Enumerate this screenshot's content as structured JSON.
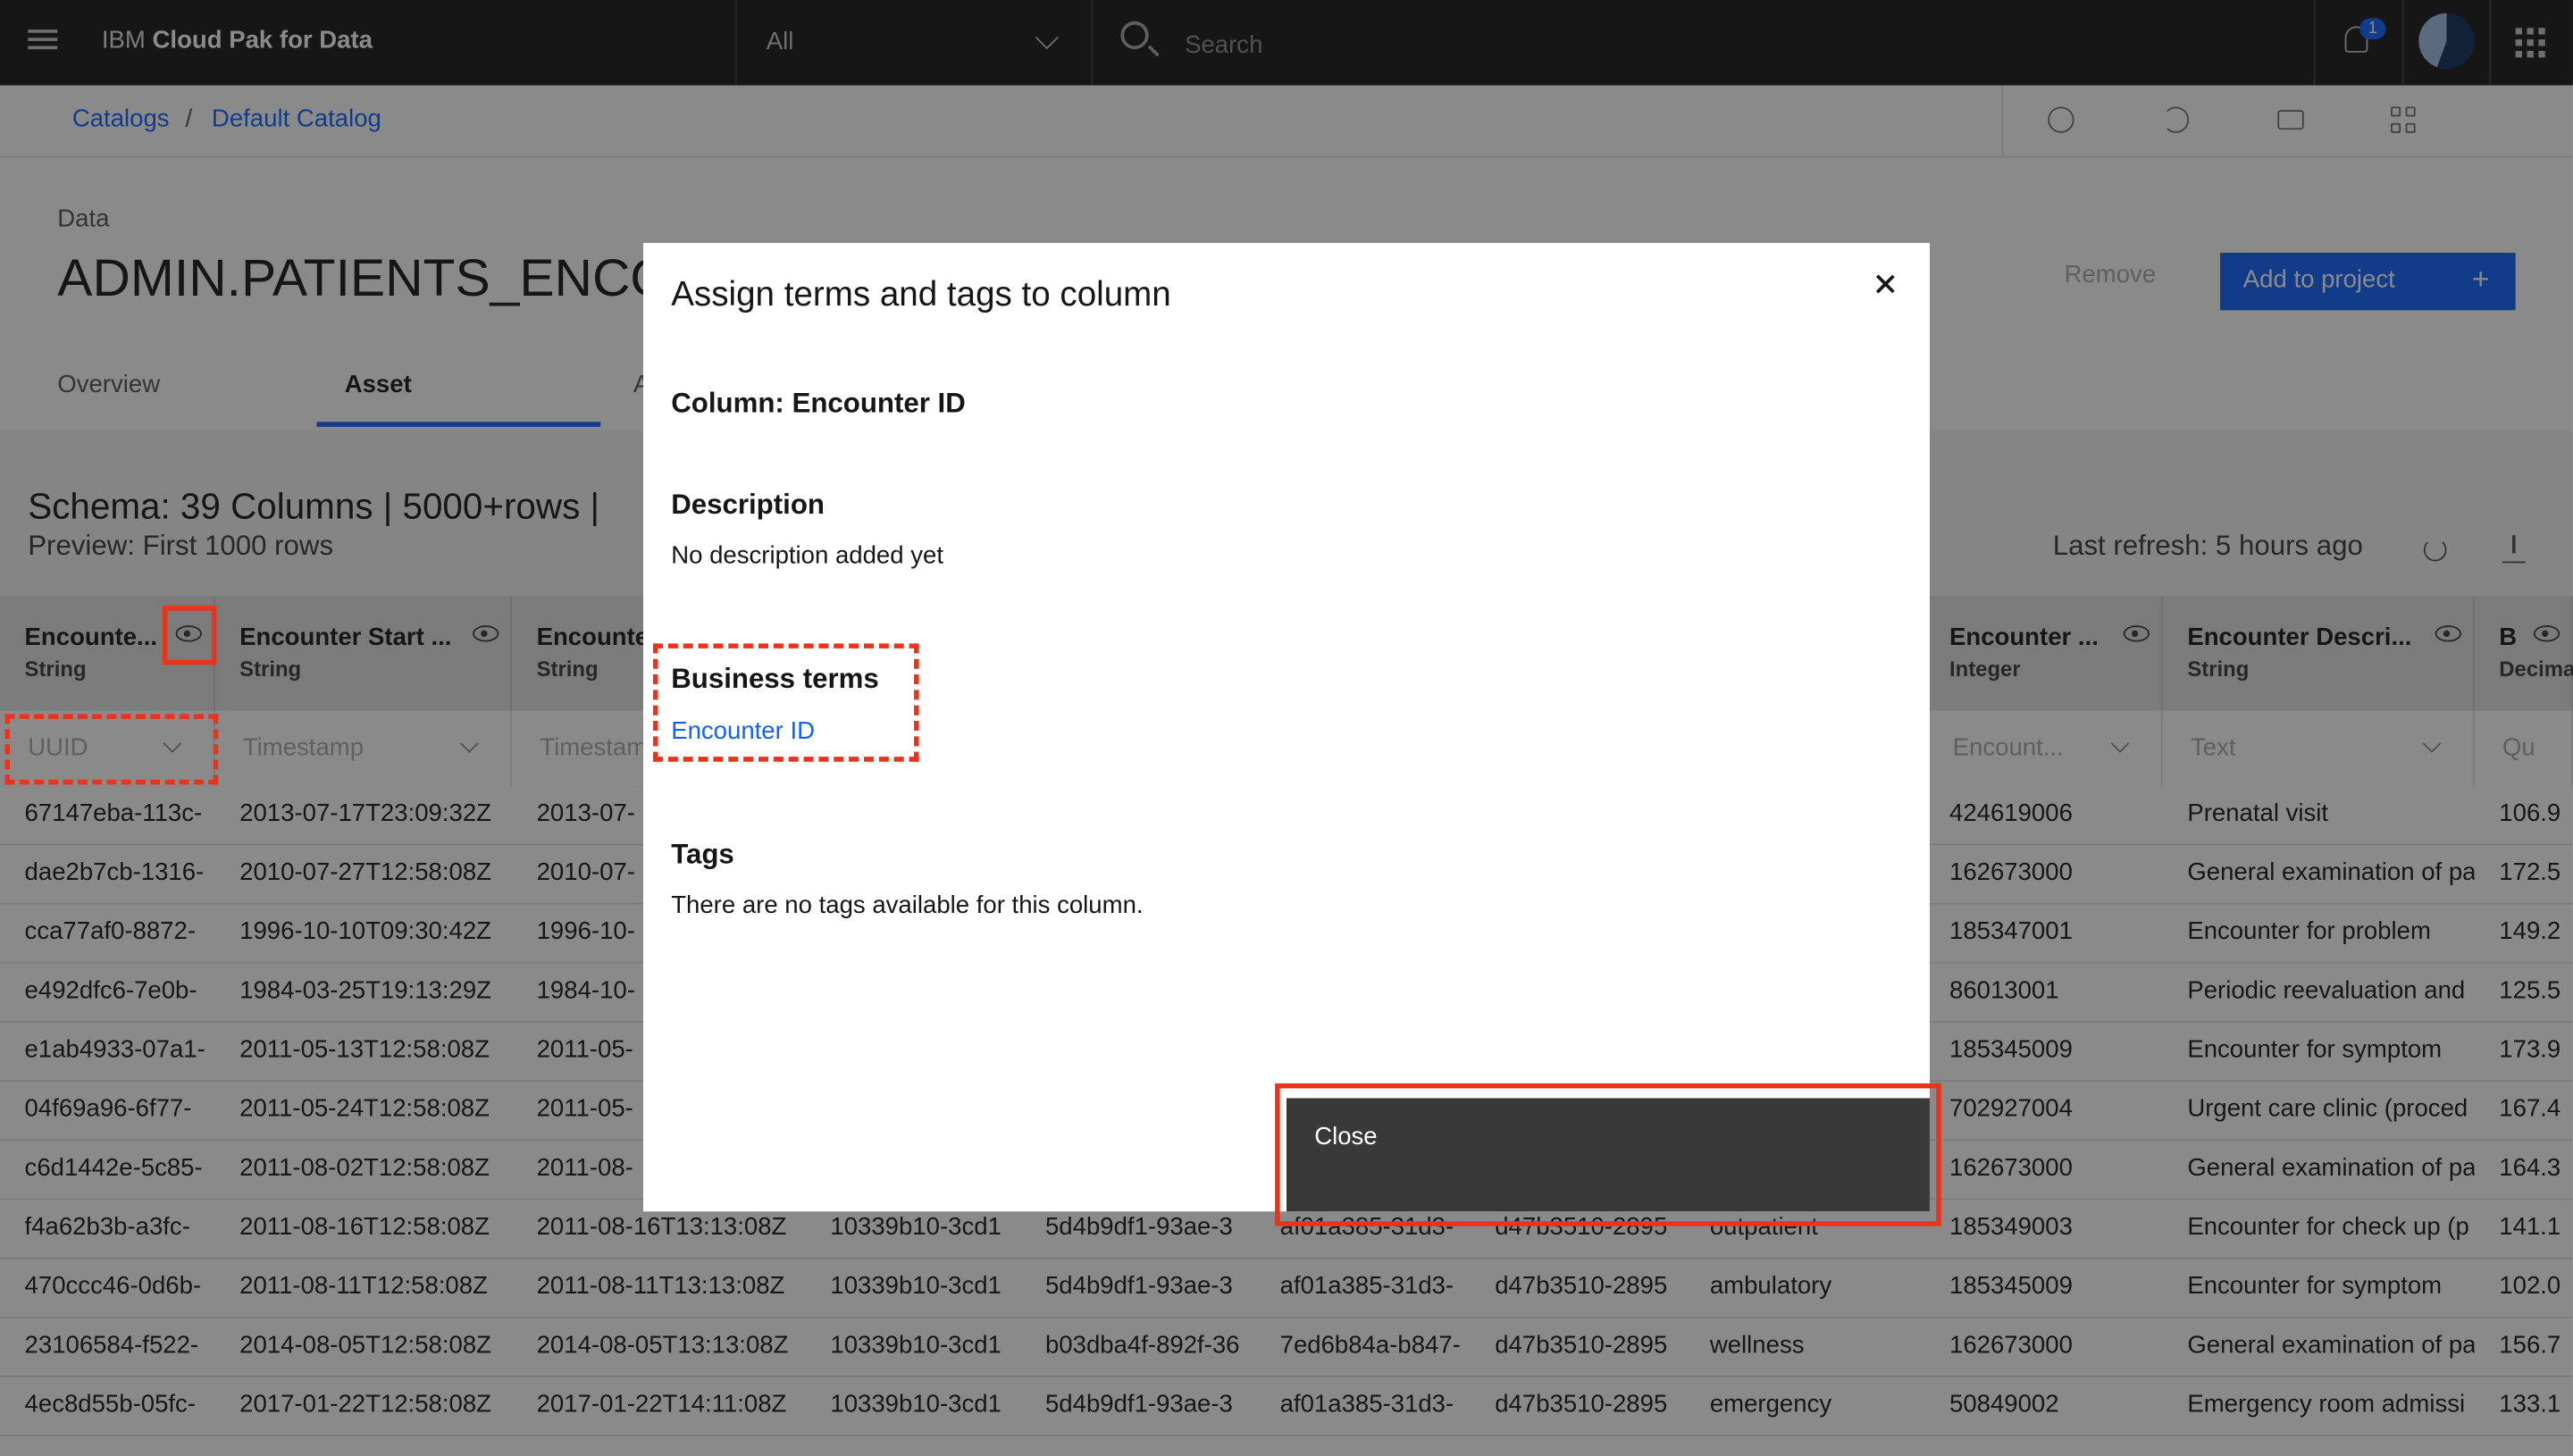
{
  "topbar": {
    "brand_prefix": "IBM",
    "brand_product": "Cloud Pak for Data",
    "scope_label": "All",
    "search_placeholder": "Search",
    "notification_count": "1"
  },
  "breadcrumb": [
    "Catalogs",
    "Default Catalog"
  ],
  "asset": {
    "eyebrow": "Data",
    "title": "ADMIN.PATIENTS_ENCOUNTERS",
    "remove_label": "Remove",
    "add_label": "Add to project",
    "tabs": [
      "Overview",
      "Asset",
      "A"
    ]
  },
  "schema": {
    "summary": "Schema:  39 Columns  |  5000+rows  |",
    "preview": "Preview: First 1000 rows",
    "last_refresh": "Last refresh: 5 hours ago"
  },
  "columns": [
    {
      "name": "Encounte...",
      "type": "String",
      "filter": "UUID"
    },
    {
      "name": "Encounter Start ...",
      "type": "String",
      "filter": "Timestamp"
    },
    {
      "name": "Encounte",
      "type": "String",
      "filter": "Timestamp"
    },
    {
      "name": "",
      "type": "",
      "filter": ""
    },
    {
      "name": "",
      "type": "",
      "filter": ""
    },
    {
      "name": "",
      "type": "",
      "filter": ""
    },
    {
      "name": "",
      "type": "",
      "filter": ""
    },
    {
      "name": "",
      "type": "",
      "filter": ""
    },
    {
      "name": "Encounter ...",
      "type": "Integer",
      "filter": "Encount..."
    },
    {
      "name": "Encounter Descri...",
      "type": "String",
      "filter": "Text"
    },
    {
      "name": "Base E",
      "type": "Decima",
      "filter": "Quant"
    }
  ],
  "rows": [
    [
      "67147eba-113c-",
      "2013-07-17T23:09:32Z",
      "2013-07-",
      "",
      "",
      "",
      "",
      "",
      "424619006",
      "Prenatal visit",
      "106.9"
    ],
    [
      "dae2b7cb-1316-",
      "2010-07-27T12:58:08Z",
      "2010-07-",
      "",
      "",
      "",
      "",
      "",
      "162673000",
      "General examination of pa",
      "172.5"
    ],
    [
      "cca77af0-8872-",
      "1996-10-10T09:30:42Z",
      "1996-10-",
      "",
      "",
      "",
      "",
      "",
      "185347001",
      "Encounter for problem",
      "149.2"
    ],
    [
      "e492dfc6-7e0b-",
      "1984-03-25T19:13:29Z",
      "1984-10-",
      "",
      "",
      "",
      "",
      "",
      "86013001",
      "Periodic reevaluation and",
      "125.5"
    ],
    [
      "e1ab4933-07a1-",
      "2011-05-13T12:58:08Z",
      "2011-05-",
      "",
      "",
      "",
      "",
      "",
      "185345009",
      "Encounter for symptom",
      "173.9"
    ],
    [
      "04f69a96-6f77-",
      "2011-05-24T12:58:08Z",
      "2011-05-",
      "",
      "",
      "",
      "",
      "",
      "702927004",
      "Urgent care clinic (proced",
      "167.4"
    ],
    [
      "c6d1442e-5c85-",
      "2011-08-02T12:58:08Z",
      "2011-08-",
      "",
      "",
      "",
      "",
      "",
      "162673000",
      "General examination of pa",
      "164.3"
    ],
    [
      "f4a62b3b-a3fc-",
      "2011-08-16T12:58:08Z",
      "2011-08-16T13:13:08Z",
      "10339b10-3cd1",
      "5d4b9df1-93ae-3",
      "af01a385-31d3-",
      "d47b3510-2895",
      "outpatient",
      "185349003",
      "Encounter for check up (p",
      "141.1"
    ],
    [
      "470ccc46-0d6b-",
      "2011-08-11T12:58:08Z",
      "2011-08-11T13:13:08Z",
      "10339b10-3cd1",
      "5d4b9df1-93ae-3",
      "af01a385-31d3-",
      "d47b3510-2895",
      "ambulatory",
      "185345009",
      "Encounter for symptom",
      "102.0"
    ],
    [
      "23106584-f522-",
      "2014-08-05T12:58:08Z",
      "2014-08-05T13:13:08Z",
      "10339b10-3cd1",
      "b03dba4f-892f-36",
      "7ed6b84a-b847-",
      "d47b3510-2895",
      "wellness",
      "162673000",
      "General examination of pa",
      "156.7"
    ],
    [
      "4ec8d55b-05fc-",
      "2017-01-22T12:58:08Z",
      "2017-01-22T14:11:08Z",
      "10339b10-3cd1",
      "5d4b9df1-93ae-3",
      "af01a385-31d3-",
      "d47b3510-2895",
      "emergency",
      "50849002",
      "Emergency room admissi",
      "133.1"
    ]
  ],
  "modal": {
    "title": "Assign terms and tags to column",
    "column_label": "Column: Encounter ID",
    "description_heading": "Description",
    "description_text": "No description added yet",
    "terms_heading": "Business terms",
    "term_link": "Encounter ID",
    "tags_heading": "Tags",
    "tags_text": "There are no tags available for this column.",
    "close_label": "Close"
  },
  "colors": {
    "accent": "#0f62fe",
    "highlight": "#e8341c",
    "topbar": "#161616"
  }
}
